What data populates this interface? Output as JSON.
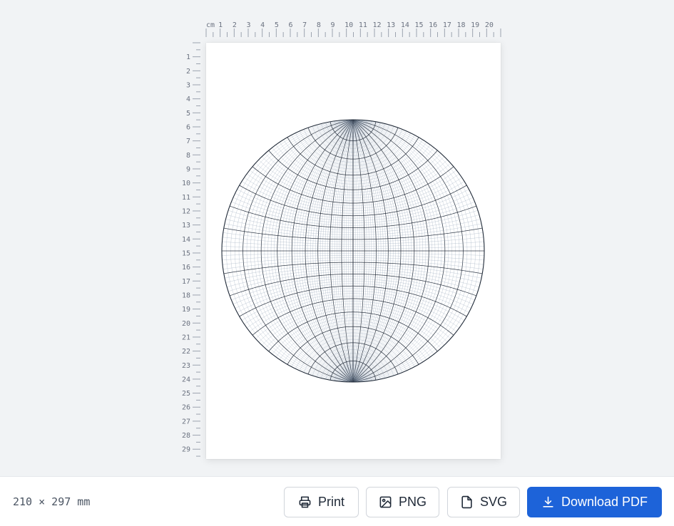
{
  "ruler": {
    "unit_label": "cm",
    "top_labels": [
      "1",
      "2",
      "3",
      "4",
      "5",
      "6",
      "7",
      "8",
      "9",
      "10",
      "11",
      "12",
      "13",
      "14",
      "15",
      "16",
      "17",
      "18",
      "19",
      "20"
    ],
    "left_labels": [
      "1",
      "2",
      "3",
      "4",
      "5",
      "6",
      "7",
      "8",
      "9",
      "10",
      "11",
      "12",
      "13",
      "14",
      "15",
      "16",
      "17",
      "18",
      "19",
      "20",
      "21",
      "22",
      "23",
      "24",
      "25",
      "26",
      "27",
      "28",
      "29"
    ]
  },
  "paper": {
    "width_mm": 210,
    "height_mm": 297,
    "net": {
      "type": "equal-angle stereonet",
      "major_grid_deg": 10,
      "minor_grid_deg": 2
    }
  },
  "footer": {
    "dimensions": "210 × 297 mm",
    "print_label": "Print",
    "png_label": "PNG",
    "svg_label": "SVG",
    "pdf_label": "Download PDF"
  },
  "colors": {
    "accent": "#1d63d9",
    "net_major": "#1f2937",
    "net_minor": "#94a3b8"
  },
  "icons": {
    "print": "printer-icon",
    "png": "image-icon",
    "svg": "file-icon",
    "pdf": "download-icon"
  }
}
